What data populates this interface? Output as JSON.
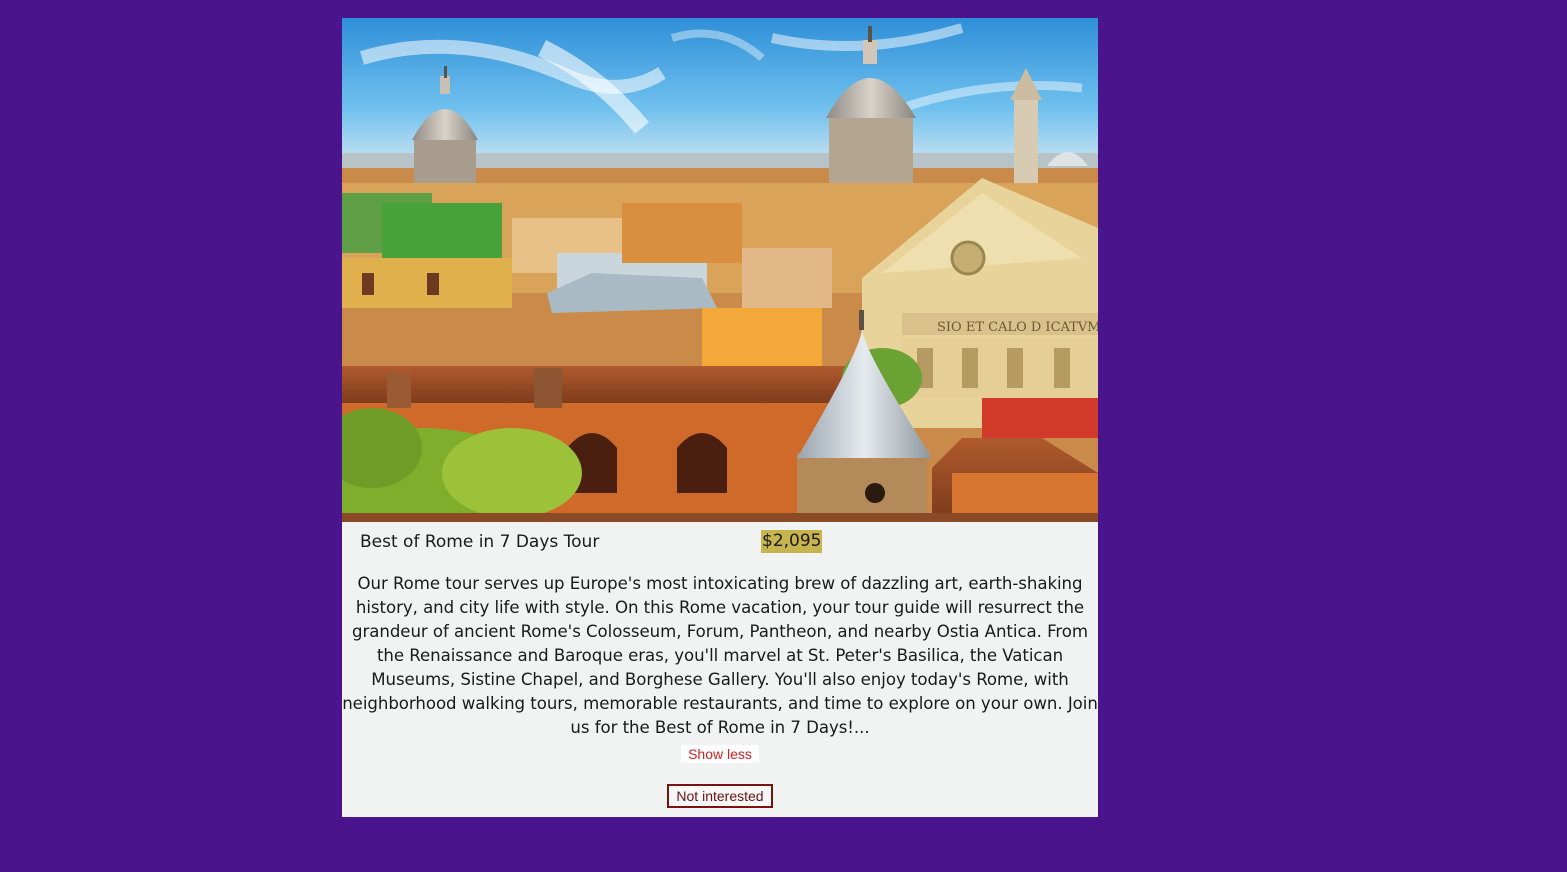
{
  "tour": {
    "image_alt": "Rome skyline with domes and terracotta rooftops",
    "name": "Best of Rome in 7 Days Tour",
    "price": "$2,095",
    "description": "Our Rome tour serves up Europe's most intoxicating brew of dazzling art, earth-shaking history, and city life with style. On this Rome vacation, your tour guide will resurrect the grandeur of ancient Rome's Colosseum, Forum, Pantheon, and nearby Ostia Antica. From the Renaissance and Baroque eras, you'll marvel at St. Peter's Basilica, the Vatican Museums, Sistine Chapel, and Borghese Gallery. You'll also enjoy today's Rome, with neighborhood walking tours, memorable restaurants, and time to explore on your own. Join us for the Best of Rome in 7 Days!...",
    "show_less_label": "Show less",
    "not_interested_label": "Not interested",
    "photo_inscription": "SIO ET CALO D ICATVM"
  },
  "colors": {
    "page_background": "#4a148c",
    "card_background": "#f1f3f2",
    "price_highlight": "#c6b44d",
    "show_less_text": "#d21f1f",
    "not_interested_border": "#7a1212"
  }
}
